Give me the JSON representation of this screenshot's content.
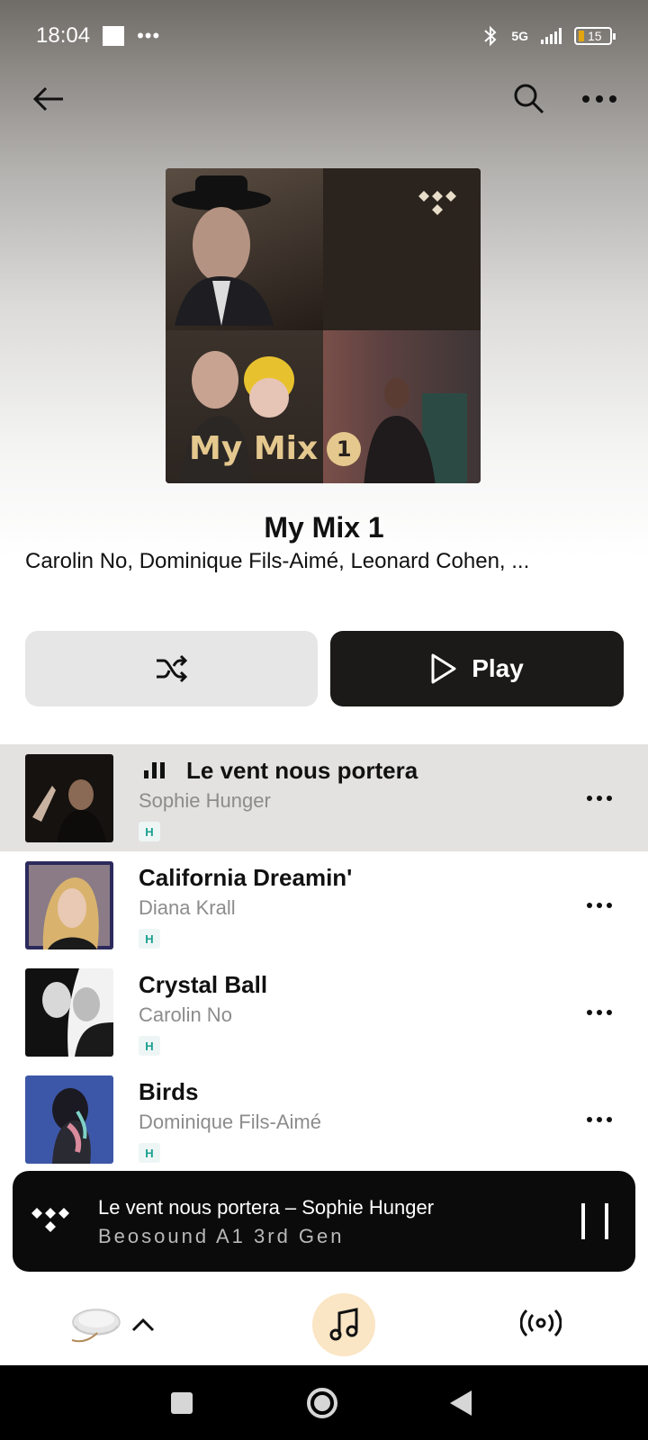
{
  "status_bar": {
    "time": "18:04",
    "network": "5G",
    "battery": "15"
  },
  "playlist": {
    "cover_text": "My Mix",
    "cover_number": "1",
    "title": "My Mix 1",
    "artists": "Carolin No, Dominique Fils-Aimé, Leonard Cohen, ..."
  },
  "actions": {
    "play_label": "Play"
  },
  "tracks": [
    {
      "title": "Le vent nous portera",
      "artist": "Sophie Hunger",
      "badge": "H",
      "playing": true
    },
    {
      "title": "California Dreamin'",
      "artist": "Diana Krall",
      "badge": "H",
      "playing": false
    },
    {
      "title": "Crystal Ball",
      "artist": "Carolin No",
      "badge": "H",
      "playing": false
    },
    {
      "title": "Birds",
      "artist": "Dominique Fils-Aimé",
      "badge": "H",
      "playing": false
    }
  ],
  "mini_player": {
    "now_playing": "Le vent nous portera – Sophie Hunger",
    "device": "Beosound A1 3rd Gen"
  },
  "colors": {
    "active_row": "#e3e2e1",
    "music_tab_accent": "#fae5c4",
    "hires_badge": "#19a090",
    "cover_gold": "#e4c88e"
  },
  "icons": [
    "back-arrow-icon",
    "search-icon",
    "more-icon",
    "tidal-logo-icon",
    "shuffle-icon",
    "play-icon",
    "playing-bars-icon",
    "pause-icon",
    "chevron-up-icon",
    "music-note-icon",
    "broadcast-icon"
  ]
}
